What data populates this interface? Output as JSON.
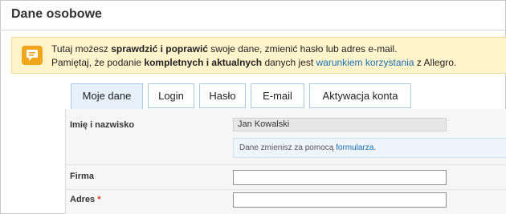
{
  "page": {
    "title": "Dane osobowe"
  },
  "info": {
    "line1": {
      "pre": "Tutaj możesz ",
      "bold": "sprawdzić i poprawić",
      "post": " swoje dane, zmienić hasło lub adres e-mail."
    },
    "line2": {
      "pre": "Pamiętaj, że podanie ",
      "bold": "kompletnych i aktualnych",
      "mid": " danych jest ",
      "link": "warunkiem korzystania",
      "post": " z Allegro."
    }
  },
  "tabs": [
    {
      "label": "Moje dane",
      "active": true
    },
    {
      "label": "Login"
    },
    {
      "label": "Hasło"
    },
    {
      "label": "E-mail"
    },
    {
      "label": "Aktywacja konta"
    }
  ],
  "form": {
    "name_label": "Imię i nazwisko",
    "name_value": "Jan Kowalski",
    "hint_text": "Dane zmienisz za pomocą ",
    "hint_link": "formularza",
    "hint_end": ".",
    "company_label": "Firma",
    "company_value": "",
    "address_label": "Adres",
    "required_mark": "*",
    "address_value": ""
  },
  "colors": {
    "accent_link": "#1a6fb5",
    "info_bg": "#fff4cc",
    "info_icon": "#f0a51a",
    "tab_active_bg": "#e6f1fb"
  }
}
